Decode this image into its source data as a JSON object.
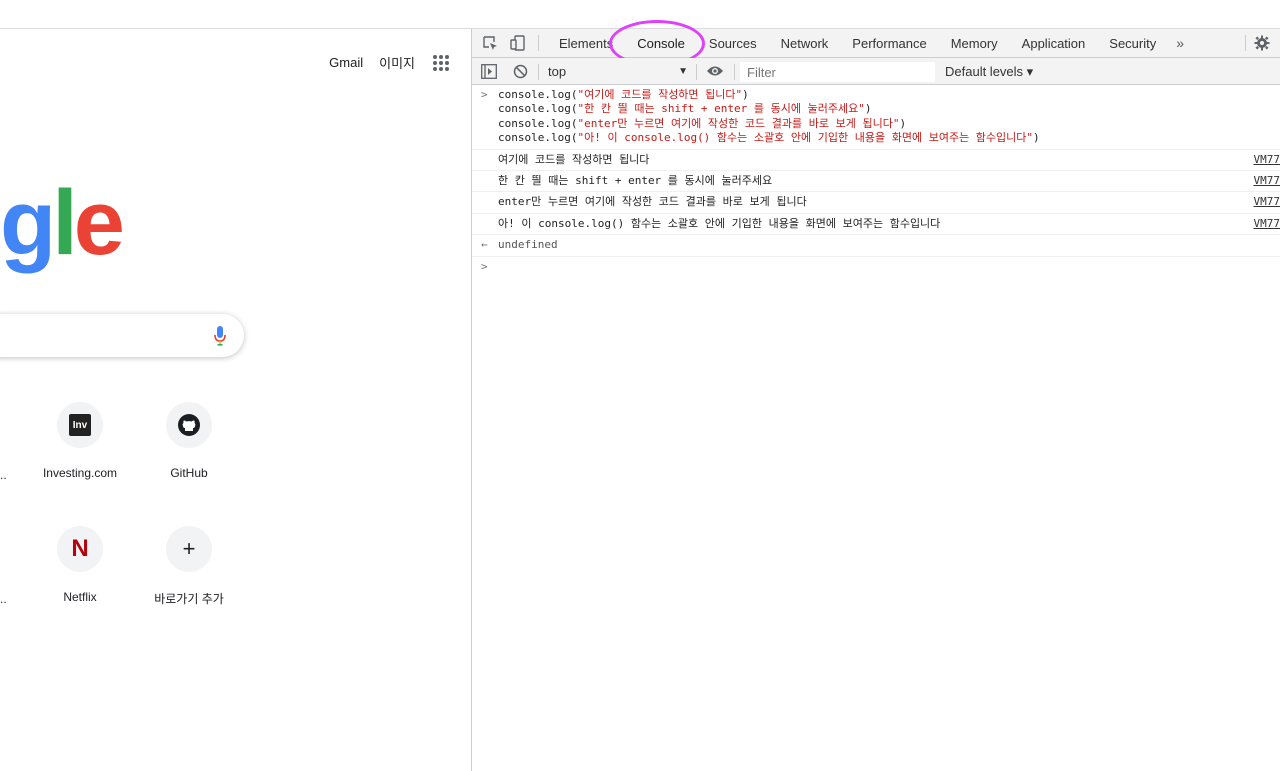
{
  "google": {
    "top_links": [
      "Gmail",
      "이미지"
    ],
    "logo_letters": [
      "g",
      "l",
      "e"
    ],
    "shortcuts": [
      {
        "label": "Investing.com",
        "icon": "investing-icon",
        "badge": "Inv"
      },
      {
        "label": "GitHub",
        "icon": "github-icon"
      },
      {
        "label": "Netflix",
        "icon": "netflix-icon",
        "badge": "N"
      },
      {
        "label": "바로가기 추가",
        "icon": "plus-icon",
        "badge": "+"
      }
    ],
    "ellipsis": ".."
  },
  "devtools": {
    "tabs": [
      {
        "label": "Elements",
        "active": false
      },
      {
        "label": "Console",
        "active": true
      },
      {
        "label": "Sources",
        "active": false
      },
      {
        "label": "Network",
        "active": false
      },
      {
        "label": "Performance",
        "active": false
      },
      {
        "label": "Memory",
        "active": false
      },
      {
        "label": "Application",
        "active": false
      },
      {
        "label": "Security",
        "active": false
      }
    ],
    "more_tabs": "»",
    "toolbar": {
      "context": "top",
      "filter_placeholder": "Filter",
      "levels": "Default levels ▾"
    },
    "console": {
      "input_prompt": ">",
      "input_lines": [
        {
          "pre": "console.log(",
          "str": "\"여기에 코드를 작성하면 됩니다\"",
          "post": ")"
        },
        {
          "pre": "console.log(",
          "str": "\"한 칸 띌 때는 shift + enter 를 동시에 눌러주세요\"",
          "post": ")"
        },
        {
          "pre": "console.log(",
          "str": "\"enter만 누르면 여기에 작성한 코드 결과를 바로 보게 됩니다\"",
          "post": ")"
        },
        {
          "pre": "console.log(",
          "str": "\"아! 이 console.log() 함수는 소괄호 안에 기입한 내용을 화면에 보여주는 함수입니다\"",
          "post": ")"
        }
      ],
      "outputs": [
        {
          "text": "여기에 코드를 작성하면 됩니다",
          "source": "VM77"
        },
        {
          "text": "한 칸 띌 때는 shift + enter 를 동시에 눌러주세요",
          "source": "VM77"
        },
        {
          "text": "enter만 누르면 여기에 작성한 코드 결과를 바로 보게 됩니다",
          "source": "VM77"
        },
        {
          "text": "아! 이 console.log() 함수는 소괄호 안에 기입한 내용을 화면에 보여주는 함수입니다",
          "source": "VM77"
        }
      ],
      "return_prompt": "←",
      "return_value": "undefined",
      "cursor_prompt": ">"
    },
    "colors": {
      "highlight_ring": "#e040fb",
      "string": "#c41a16",
      "prompt_blue": "#1a73e8"
    }
  }
}
